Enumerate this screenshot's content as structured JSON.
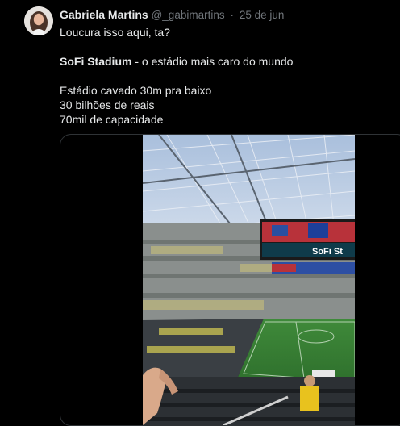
{
  "tweet": {
    "author_name": "Gabriela Martins",
    "author_handle": "@_gabimartins",
    "separator": "·",
    "date": "25 de jun",
    "line1": "Loucura isso aqui, ta?",
    "line2_bold": "SoFi Stadium",
    "line2_rest": " - o estádio mais caro do mundo",
    "line3": "Estádio cavado 30m pra baixo",
    "line4": "30 bilhões de reais",
    "line5": "70mil de capacidade"
  },
  "media": {
    "screen_text": "SoFi St"
  }
}
